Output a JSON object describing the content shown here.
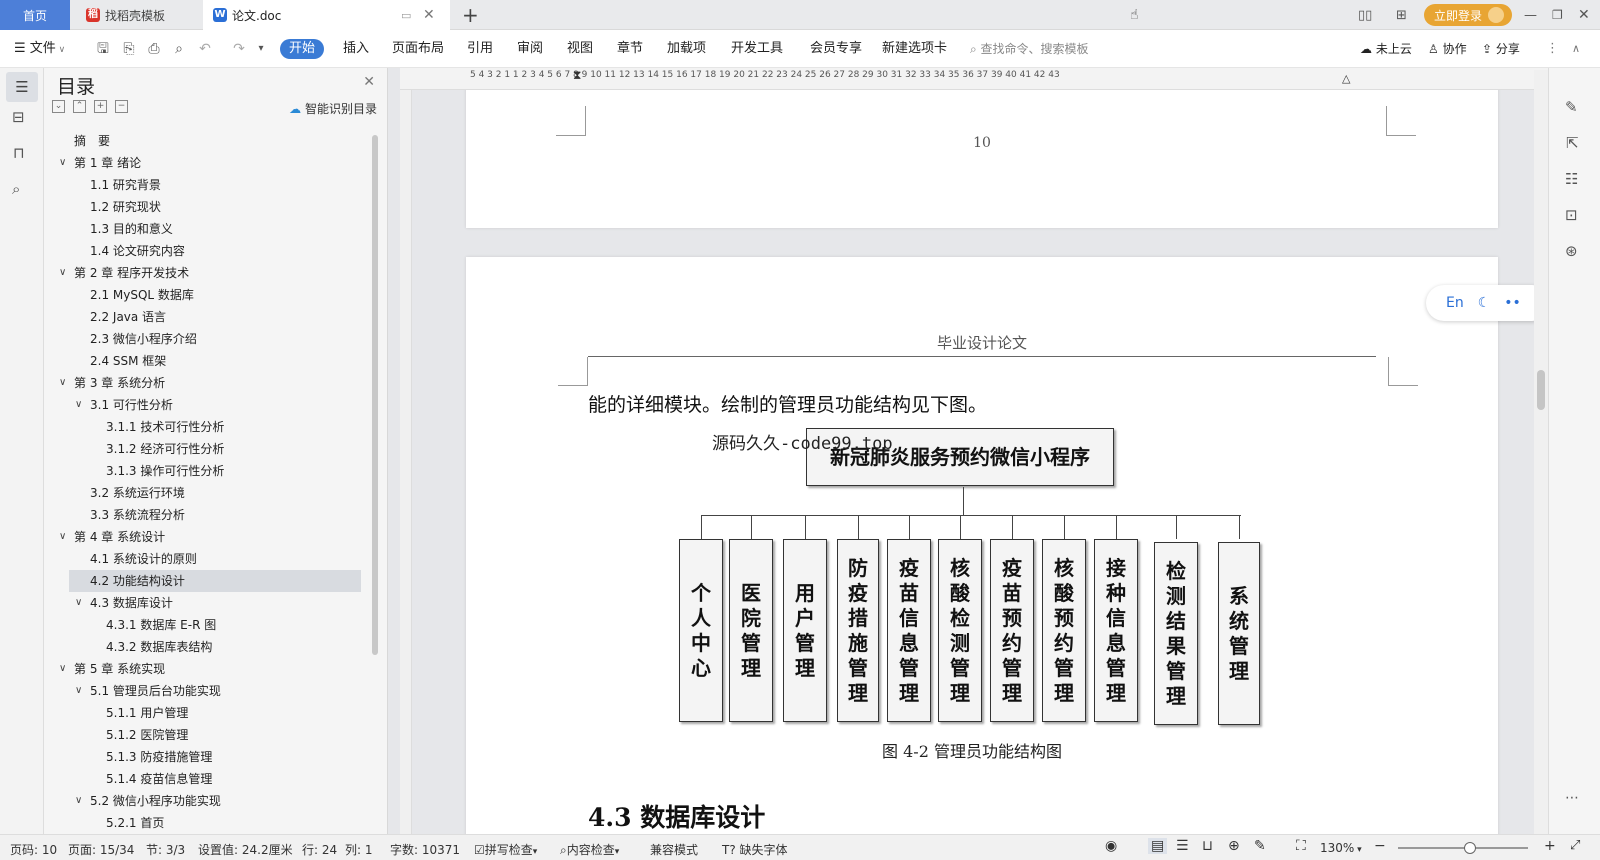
{
  "tabs": {
    "home": "首页",
    "template": "找稻壳模板",
    "doc": "论文.doc"
  },
  "account": {
    "login": "立即登录"
  },
  "toolbar": {
    "file": "文件",
    "menus": [
      "开始",
      "插入",
      "页面布局",
      "引用",
      "审阅",
      "视图",
      "章节",
      "加载项",
      "开发工具",
      "会员专享",
      "新建选项卡"
    ],
    "search_placeholder": "查找命令、搜索模板",
    "cloud": "未上云",
    "collab": "协作",
    "share": "分享"
  },
  "ruler": {
    "numbers": "5   4   3   2   1       1   2   3   4   5   6   7   8   9  10  11  12  13  14  15  16  17  18  19  20  21  22  23  24  25  26  27  28  29  30  31  32  33  34  35  36  37      39  40  41  42  43"
  },
  "toc": {
    "title": "目录",
    "smart": "智能识别目录",
    "items": [
      {
        "label": "摘　要",
        "level": 0
      },
      {
        "label": "第 1 章  绪论",
        "level": 1,
        "arrow": true
      },
      {
        "label": "1.1  研究背景",
        "level": 2
      },
      {
        "label": "1.2  研究现状",
        "level": 2
      },
      {
        "label": "1.3  目的和意义",
        "level": 2
      },
      {
        "label": "1.4  论文研究内容",
        "level": 2
      },
      {
        "label": "第 2 章  程序开发技术",
        "level": 1,
        "arrow": true
      },
      {
        "label": "2.1 MySQL 数据库",
        "level": 2
      },
      {
        "label": "2.2 Java 语言",
        "level": 2
      },
      {
        "label": "2.3  微信小程序介绍",
        "level": 2
      },
      {
        "label": "2.4 SSM 框架",
        "level": 2
      },
      {
        "label": "第 3 章  系统分析",
        "level": 1,
        "arrow": true
      },
      {
        "label": "3.1 可行性分析",
        "level": 2,
        "arrow": true
      },
      {
        "label": "3.1.1 技术可行性分析",
        "level": 3
      },
      {
        "label": "3.1.2 经济可行性分析",
        "level": 3
      },
      {
        "label": "3.1.3 操作可行性分析",
        "level": 3
      },
      {
        "label": "3.2 系统运行环境",
        "level": 2
      },
      {
        "label": "3.3 系统流程分析",
        "level": 2
      },
      {
        "label": "第 4 章  系统设计",
        "level": 1,
        "arrow": true
      },
      {
        "label": "4.1  系统设计的原则",
        "level": 2
      },
      {
        "label": "4.2  功能结构设计",
        "level": 2,
        "selected": true
      },
      {
        "label": "4.3  数据库设计",
        "level": 2,
        "arrow": true
      },
      {
        "label": "4.3.1  数据库 E-R 图",
        "level": 3
      },
      {
        "label": "4.3.2  数据库表结构",
        "level": 3
      },
      {
        "label": "第 5 章  系统实现",
        "level": 1,
        "arrow": true
      },
      {
        "label": "5.1 管理员后台功能实现",
        "level": 2,
        "arrow": true
      },
      {
        "label": "5.1.1  用户管理",
        "level": 3
      },
      {
        "label": "5.1.2  医院管理",
        "level": 3
      },
      {
        "label": "5.1.3  防疫措施管理",
        "level": 3
      },
      {
        "label": "5.1.4  疫苗信息管理",
        "level": 3
      },
      {
        "label": "5.2  微信小程序功能实现",
        "level": 2,
        "arrow": true
      },
      {
        "label": "5.2.1  首页",
        "level": 3
      }
    ]
  },
  "doc": {
    "page_number": "10",
    "header": "毕业设计论文",
    "intro": "能的详细模块。绘制的管理员功能结构见下图。",
    "watermark": "源码久久-code99.top",
    "diagram_root": "新冠肺炎服务预约微信小程序",
    "modules": [
      "个人中心",
      "医院管理",
      "用户管理",
      "防疫措施管理",
      "疫苗信息管理",
      "核酸检测管理",
      "疫苗预约管理",
      "核酸预约管理",
      "接种信息管理",
      "检测结果管理",
      "系统管理"
    ],
    "caption": "图 4-2  管理员功能结构图",
    "next_heading": "4.3  数据库设计"
  },
  "float_toolbar": {
    "en": "En"
  },
  "status": {
    "page": "页码: 10",
    "pages": "页面: 15/34",
    "section": "节: 3/3",
    "setting": "设置值: 24.2厘米",
    "row": "行: 24",
    "col": "列: 1",
    "words": "字数: 10371",
    "spell": "拼写检查",
    "content": "内容检查",
    "compat": "兼容模式",
    "font": "缺失字体",
    "zoom": "130%"
  }
}
